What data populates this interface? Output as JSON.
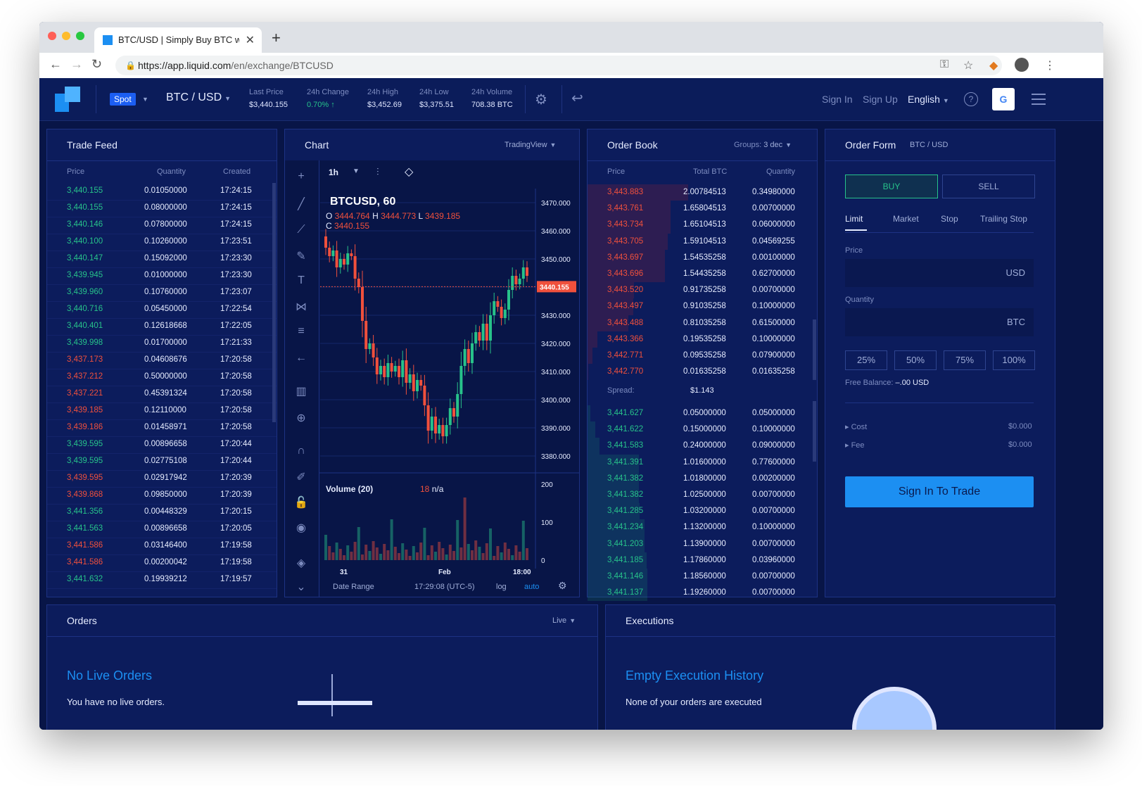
{
  "browser": {
    "tab_title": "BTC/USD | Simply Buy BTC wit",
    "url_host": "https://app.liquid.com",
    "url_path": "/en/exchange/BTCUSD"
  },
  "topnav": {
    "spot": "Spot",
    "pair": "BTC / USD",
    "stats": [
      {
        "label": "Last Price",
        "value": "$3,440.155"
      },
      {
        "label": "24h Change",
        "value": "0.70% ↑"
      },
      {
        "label": "24h High",
        "value": "$3,452.69"
      },
      {
        "label": "24h Low",
        "value": "$3,375.51"
      },
      {
        "label": "24h Volume",
        "value": "708.38 BTC"
      }
    ],
    "sign_in": "Sign In",
    "sign_up": "Sign Up",
    "language": "English"
  },
  "trade_feed": {
    "title": "Trade Feed",
    "columns": [
      "Price",
      "Quantity",
      "Created"
    ],
    "rows": [
      {
        "price": "3,440.155",
        "qty": "0.01050000",
        "time": "17:24:15",
        "side": "g"
      },
      {
        "price": "3,440.155",
        "qty": "0.08000000",
        "time": "17:24:15",
        "side": "g"
      },
      {
        "price": "3,440.146",
        "qty": "0.07800000",
        "time": "17:24:15",
        "side": "g"
      },
      {
        "price": "3,440.100",
        "qty": "0.10260000",
        "time": "17:23:51",
        "side": "g"
      },
      {
        "price": "3,440.147",
        "qty": "0.15092000",
        "time": "17:23:30",
        "side": "g"
      },
      {
        "price": "3,439.945",
        "qty": "0.01000000",
        "time": "17:23:30",
        "side": "g"
      },
      {
        "price": "3,439.960",
        "qty": "0.10760000",
        "time": "17:23:07",
        "side": "g"
      },
      {
        "price": "3,440.716",
        "qty": "0.05450000",
        "time": "17:22:54",
        "side": "g"
      },
      {
        "price": "3,440.401",
        "qty": "0.12618668",
        "time": "17:22:05",
        "side": "g"
      },
      {
        "price": "3,439.998",
        "qty": "0.01700000",
        "time": "17:21:33",
        "side": "g"
      },
      {
        "price": "3,437.173",
        "qty": "0.04608676",
        "time": "17:20:58",
        "side": "r"
      },
      {
        "price": "3,437.212",
        "qty": "0.50000000",
        "time": "17:20:58",
        "side": "r"
      },
      {
        "price": "3,437.221",
        "qty": "0.45391324",
        "time": "17:20:58",
        "side": "r"
      },
      {
        "price": "3,439.185",
        "qty": "0.12110000",
        "time": "17:20:58",
        "side": "r"
      },
      {
        "price": "3,439.186",
        "qty": "0.01458971",
        "time": "17:20:58",
        "side": "r"
      },
      {
        "price": "3,439.595",
        "qty": "0.00896658",
        "time": "17:20:44",
        "side": "g"
      },
      {
        "price": "3,439.595",
        "qty": "0.02775108",
        "time": "17:20:44",
        "side": "g"
      },
      {
        "price": "3,439.595",
        "qty": "0.02917942",
        "time": "17:20:39",
        "side": "r"
      },
      {
        "price": "3,439.868",
        "qty": "0.09850000",
        "time": "17:20:39",
        "side": "r"
      },
      {
        "price": "3,441.356",
        "qty": "0.00448329",
        "time": "17:20:15",
        "side": "g"
      },
      {
        "price": "3,441.563",
        "qty": "0.00896658",
        "time": "17:20:05",
        "side": "g"
      },
      {
        "price": "3,441.586",
        "qty": "0.03146400",
        "time": "17:19:58",
        "side": "r"
      },
      {
        "price": "3,441.586",
        "qty": "0.00200042",
        "time": "17:19:58",
        "side": "r"
      },
      {
        "price": "3,441.632",
        "qty": "0.19939212",
        "time": "17:19:57",
        "side": "g"
      }
    ]
  },
  "chart": {
    "title": "Chart",
    "provider": "TradingView",
    "interval": "1h",
    "symbol": "BTCUSD, 60",
    "ohlc": {
      "o": "3444.764",
      "h": "3444.773",
      "l": "3439.185",
      "c": "3440.155"
    },
    "price_ticks": [
      "3470.000",
      "3460.000",
      "3450.000",
      "3440.000",
      "3430.000",
      "3420.000",
      "3410.000",
      "3400.000",
      "3390.000",
      "3380.000"
    ],
    "last_price_label": "3440.155",
    "volume_label": "Volume (20)",
    "volume_val": "18",
    "volume_na": "n/a",
    "volume_ticks": [
      "200",
      "100",
      "0"
    ],
    "x_ticks": [
      "31",
      "Feb",
      "18:00"
    ],
    "date_range": "Date Range",
    "clock": "17:29:08 (UTC-5)",
    "log": "log",
    "auto": "auto"
  },
  "order_book": {
    "title": "Order Book",
    "groups_label": "Groups:",
    "groups_value": "3 dec",
    "columns": [
      "Price",
      "Total BTC",
      "Quantity"
    ],
    "asks": [
      {
        "price": "3,443.883",
        "total": "2.00784513",
        "qty": "0.34980000"
      },
      {
        "price": "3,443.761",
        "total": "1.65804513",
        "qty": "0.00700000"
      },
      {
        "price": "3,443.734",
        "total": "1.65104513",
        "qty": "0.06000000"
      },
      {
        "price": "3,443.705",
        "total": "1.59104513",
        "qty": "0.04569255"
      },
      {
        "price": "3,443.697",
        "total": "1.54535258",
        "qty": "0.00100000"
      },
      {
        "price": "3,443.696",
        "total": "1.54435258",
        "qty": "0.62700000"
      },
      {
        "price": "3,443.520",
        "total": "0.91735258",
        "qty": "0.00700000"
      },
      {
        "price": "3,443.497",
        "total": "0.91035258",
        "qty": "0.10000000"
      },
      {
        "price": "3,443.488",
        "total": "0.81035258",
        "qty": "0.61500000"
      },
      {
        "price": "3,443.366",
        "total": "0.19535258",
        "qty": "0.10000000"
      },
      {
        "price": "3,442.771",
        "total": "0.09535258",
        "qty": "0.07900000"
      },
      {
        "price": "3,442.770",
        "total": "0.01635258",
        "qty": "0.01635258"
      }
    ],
    "spread_label": "Spread:",
    "spread_value": "$1.143",
    "bids": [
      {
        "price": "3,441.627",
        "total": "0.05000000",
        "qty": "0.05000000"
      },
      {
        "price": "3,441.622",
        "total": "0.15000000",
        "qty": "0.10000000"
      },
      {
        "price": "3,441.583",
        "total": "0.24000000",
        "qty": "0.09000000"
      },
      {
        "price": "3,441.391",
        "total": "1.01600000",
        "qty": "0.77600000"
      },
      {
        "price": "3,441.382",
        "total": "1.01800000",
        "qty": "0.00200000"
      },
      {
        "price": "3,441.382",
        "total": "1.02500000",
        "qty": "0.00700000"
      },
      {
        "price": "3,441.285",
        "total": "1.03200000",
        "qty": "0.00700000"
      },
      {
        "price": "3,441.234",
        "total": "1.13200000",
        "qty": "0.10000000"
      },
      {
        "price": "3,441.203",
        "total": "1.13900000",
        "qty": "0.00700000"
      },
      {
        "price": "3,441.185",
        "total": "1.17860000",
        "qty": "0.03960000"
      },
      {
        "price": "3,441.146",
        "total": "1.18560000",
        "qty": "0.00700000"
      },
      {
        "price": "3,441.137",
        "total": "1.19260000",
        "qty": "0.00700000"
      }
    ]
  },
  "order_form": {
    "title": "Order Form",
    "pair": "BTC / USD",
    "buy": "BUY",
    "sell": "SELL",
    "tabs": [
      "Limit",
      "Market",
      "Stop",
      "Trailing Stop"
    ],
    "price_label": "Price",
    "price_unit": "USD",
    "qty_label": "Quantity",
    "qty_unit": "BTC",
    "pcts": [
      "25%",
      "50%",
      "75%",
      "100%"
    ],
    "free_balance_label": "Free Balance:",
    "free_balance_value": "–.00 USD",
    "cost_label": "Cost",
    "cost_value": "$0.000",
    "fee_label": "Fee",
    "fee_value": "$0.000",
    "sign_in_button": "Sign In To Trade"
  },
  "orders": {
    "title": "Orders",
    "filter": "Live",
    "empty_title": "No Live Orders",
    "empty_text": "You have no live orders."
  },
  "executions": {
    "title": "Executions",
    "empty_title": "Empty Execution History",
    "empty_text": "None of your orders are executed"
  },
  "colors": {
    "up": "#27c28a",
    "down": "#f0503c",
    "accent": "#1c8ff2",
    "bg": "#081547",
    "panel": "#0c1c5c"
  }
}
